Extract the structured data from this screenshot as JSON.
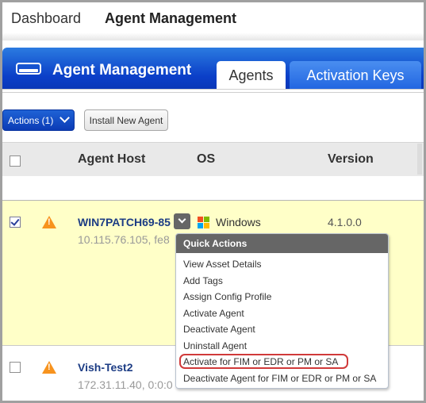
{
  "topnav": {
    "items": [
      {
        "label": "Dashboard",
        "active": false
      },
      {
        "label": "Agent Management",
        "active": true
      }
    ]
  },
  "header": {
    "icon": "hard-drive-icon",
    "title": "Agent Management",
    "tabs": [
      {
        "label": "Agents",
        "active": true
      },
      {
        "label": "Activation Keys",
        "active": false
      }
    ]
  },
  "toolbar": {
    "actions_label": "Actions (1)",
    "install_label": "Install New Agent"
  },
  "table": {
    "columns": [
      "Agent Host",
      "OS",
      "Version"
    ],
    "rows": [
      {
        "selected": true,
        "status_icon": "warning-icon",
        "host": "WIN7PATCH69-85",
        "address": "10.115.76.105, fe8",
        "os": "Windows",
        "os_icon": "windows-logo-icon",
        "version": "4.1.0.0"
      },
      {
        "selected": false,
        "status_icon": "warning-icon",
        "host": "Vish-Test2",
        "address": "172.31.11.40, 0:0:0",
        "os": "",
        "version": ""
      }
    ]
  },
  "quick_actions": {
    "title": "Quick Actions",
    "items": [
      {
        "label": "View Asset Details",
        "highlighted": false
      },
      {
        "label": "Add Tags",
        "highlighted": false
      },
      {
        "label": "Assign Config Profile",
        "highlighted": false
      },
      {
        "label": "Activate Agent",
        "highlighted": false
      },
      {
        "label": "Deactivate Agent",
        "highlighted": false
      },
      {
        "label": "Uninstall Agent",
        "highlighted": false
      },
      {
        "label": "Activate for FIM or EDR or PM or SA",
        "highlighted": true
      },
      {
        "label": "Deactivate Agent for FIM or EDR or PM or SA",
        "highlighted": false
      }
    ]
  },
  "colors": {
    "brand_blue": "#0b3fc8",
    "selected_row": "#ffffc8",
    "warning": "#f7931e",
    "host_link": "#1c3c84",
    "highlight_outline": "#d03a3a"
  }
}
